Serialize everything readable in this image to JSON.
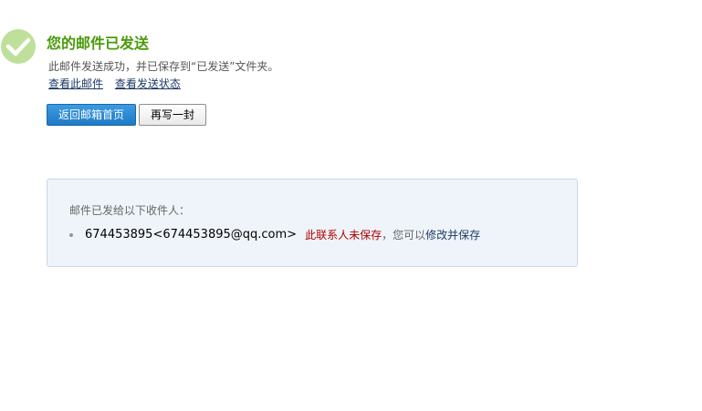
{
  "status": {
    "title": "您的邮件已发送",
    "description": "此邮件发送成功，并已保存到“已发送”文件夹。",
    "links": {
      "view_mail": "查看此邮件",
      "view_status": "查看发送状态"
    },
    "icon": "check-circle-icon",
    "accent_color": "#4a9a0a"
  },
  "buttons": {
    "back_to_inbox": "返回邮箱首页",
    "write_another": "再写一封"
  },
  "recipients": {
    "heading": "邮件已发给以下收件人：",
    "items": [
      {
        "address": "674453895<674453895@qq.com>",
        "unsaved_label": "此联系人未保存",
        "hint": "，您可以",
        "action_label": "修改并保存"
      }
    ]
  }
}
